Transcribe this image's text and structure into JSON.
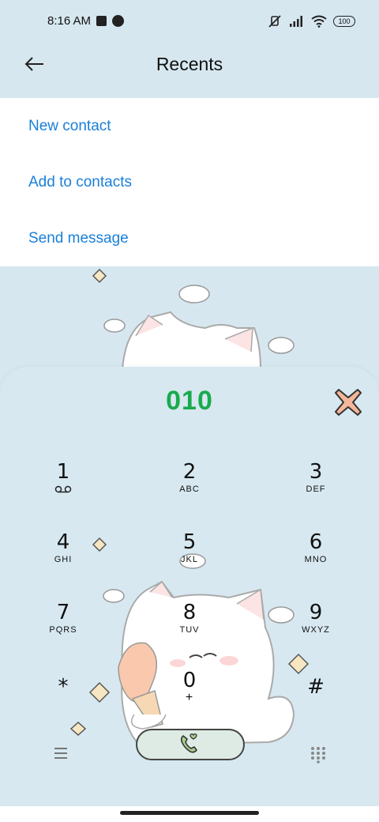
{
  "status_bar": {
    "time": "8:16 AM",
    "battery": "100",
    "icons": [
      "notification-square-icon",
      "notification-circle-icon",
      "mute-icon",
      "signal-icon",
      "wifi-icon",
      "battery-icon"
    ]
  },
  "header": {
    "title": "Recents",
    "back_icon": "arrow-left-icon"
  },
  "menu": {
    "items": [
      {
        "label": "New contact"
      },
      {
        "label": "Add to contacts"
      },
      {
        "label": "Send message"
      }
    ]
  },
  "dialer": {
    "number": "010",
    "delete_icon": "delete-x-icon",
    "keys": [
      {
        "digit": "1",
        "letters": "",
        "sub_icon": "voicemail-icon"
      },
      {
        "digit": "2",
        "letters": "ABC"
      },
      {
        "digit": "3",
        "letters": "DEF"
      },
      {
        "digit": "4",
        "letters": "GHI"
      },
      {
        "digit": "5",
        "letters": "JKL"
      },
      {
        "digit": "6",
        "letters": "MNO"
      },
      {
        "digit": "7",
        "letters": "PQRS"
      },
      {
        "digit": "8",
        "letters": "TUV"
      },
      {
        "digit": "9",
        "letters": "WXYZ"
      },
      {
        "digit": "*",
        "letters": ""
      },
      {
        "digit": "0",
        "letters": "+"
      },
      {
        "digit": "#",
        "letters": ""
      }
    ],
    "bottom_icons": [
      "menu-lines-icon",
      "phone-call-icon",
      "dialpad-grid-icon"
    ]
  },
  "colors": {
    "background": "#d6e7ef",
    "accent_blue": "#1a7fd8",
    "number_green": "#1aaa4e",
    "delete_orange": "#f4b79a"
  }
}
